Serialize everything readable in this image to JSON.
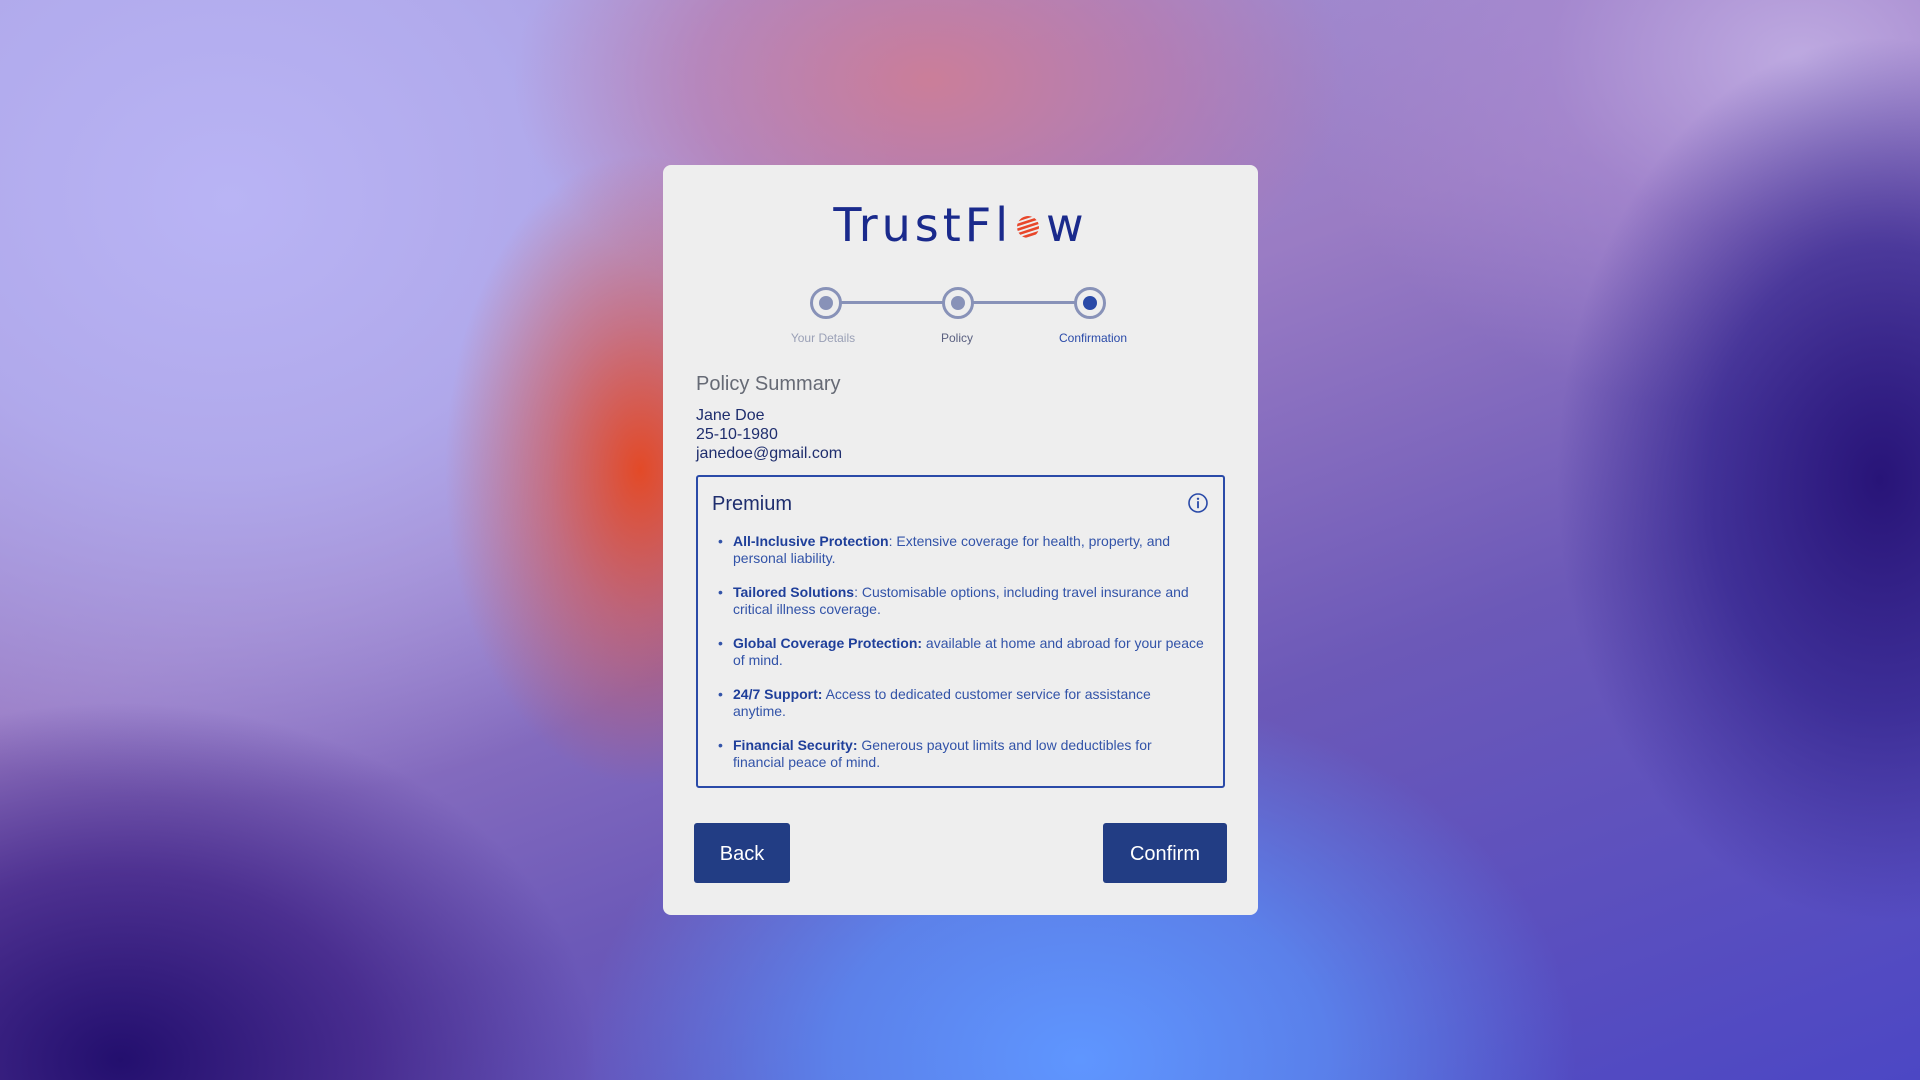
{
  "brand": {
    "name_left": "TrustFl",
    "name_right": "w",
    "icon": "striped-sun-logo-icon",
    "colors": {
      "text": "#1a2a8c",
      "logo_mark": "#e8462a"
    }
  },
  "stepper": {
    "steps": [
      {
        "label": "Your Details",
        "state": "complete"
      },
      {
        "label": "Policy",
        "state": "complete"
      },
      {
        "label": "Confirmation",
        "state": "current"
      }
    ]
  },
  "summary": {
    "title": "Policy Summary",
    "name": "Jane Doe",
    "dob": "25-10-1980",
    "email": "janedoe@gmail.com"
  },
  "premium": {
    "title": "Premium",
    "info_icon": "info-icon",
    "features": [
      {
        "title": "All-Inclusive Protection",
        "text": ": Extensive coverage for health, property, and personal liability."
      },
      {
        "title": "Tailored Solutions",
        "text": ": Customisable options, including travel insurance and critical illness coverage."
      },
      {
        "title": "Global Coverage Protection:",
        "text": " available at home and abroad for your peace of mind."
      },
      {
        "title": "24/7 Support:",
        "text": " Access to dedicated customer service for assistance anytime."
      },
      {
        "title": "Financial Security:",
        "text": " Generous payout limits and low deductibles for financial peace of mind."
      }
    ]
  },
  "actions": {
    "back_label": "Back",
    "confirm_label": "Confirm",
    "button_color": "#223d84"
  }
}
